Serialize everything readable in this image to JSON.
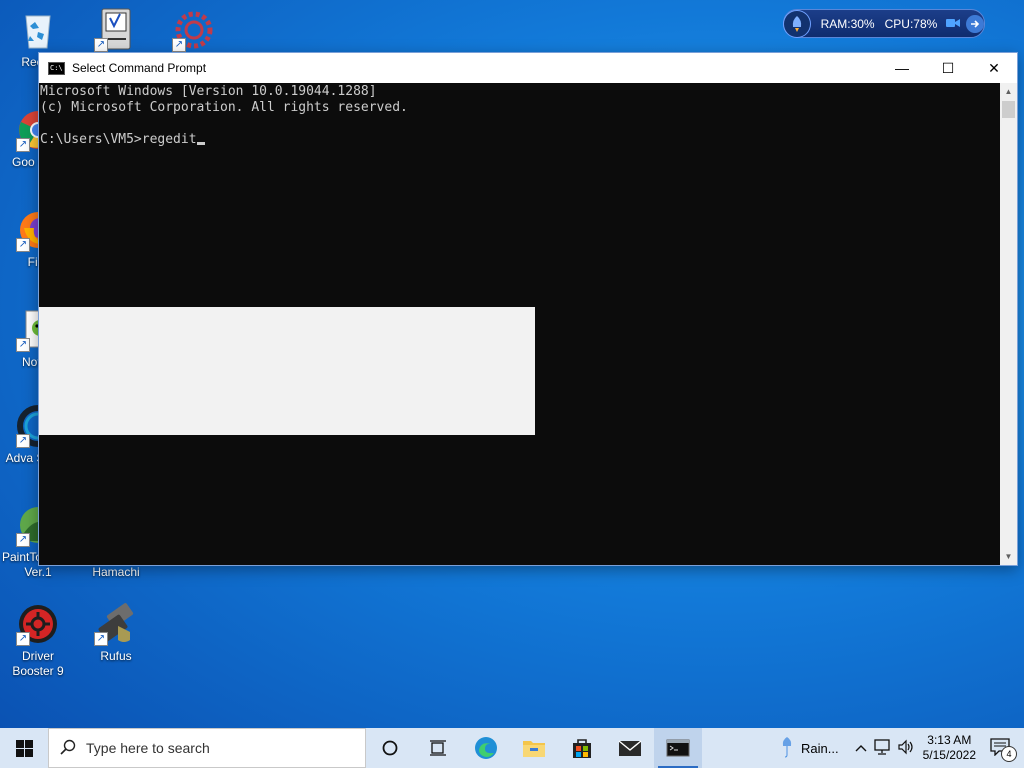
{
  "desktop_icons": [
    {
      "label": "Recyc",
      "icon": "recycle-bin-icon"
    },
    {
      "label": "",
      "icon": "classic-mac-icon"
    },
    {
      "label": "",
      "icon": "red-gear-icon"
    },
    {
      "label": "Goo Chro",
      "icon": "chrome-icon"
    },
    {
      "label": "Fire",
      "icon": "firefox-icon"
    },
    {
      "label": "Notep",
      "icon": "notepad-icon"
    },
    {
      "label": "Adva Syster",
      "icon": "advanced-systemcare-icon"
    },
    {
      "label": "PaintTool SAI Ver.1",
      "icon": "painttool-sai-icon"
    },
    {
      "label": "LogMeIn Hamachi",
      "icon": "hamachi-icon"
    },
    {
      "label": "Driver Booster 9",
      "icon": "driver-booster-icon"
    },
    {
      "label": "Rufus",
      "icon": "rufus-icon"
    }
  ],
  "perf_widget": {
    "ram": "RAM:30%",
    "cpu": "CPU:78%"
  },
  "window": {
    "title": "Select Command Prompt",
    "minimize": "—",
    "maximize": "☐",
    "close": "✕",
    "lines": [
      "Microsoft Windows [Version 10.0.19044.1288]",
      "(c) Microsoft Corporation. All rights reserved.",
      "",
      "C:\\Users\\VM5>regedit"
    ]
  },
  "taskbar": {
    "search_placeholder": "Type here to search",
    "weather": "Rain...",
    "time": "3:13 AM",
    "date": "5/15/2022",
    "notification_count": "4"
  },
  "colors": {
    "console_bg": "#0c0c0c",
    "console_text": "#cccccc",
    "accent": "#2b6cc4"
  }
}
